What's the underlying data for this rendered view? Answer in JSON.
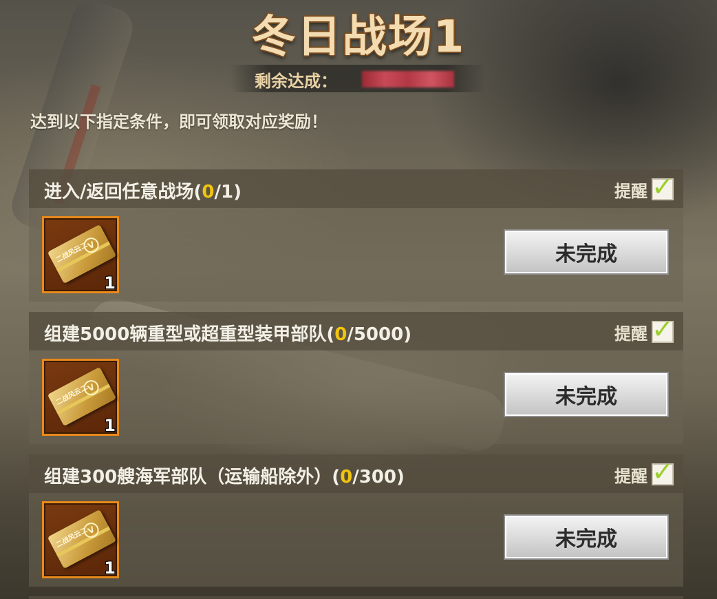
{
  "page": {
    "title": "冬日战场1",
    "remaining_label": "剩余达成：",
    "instruction": "达到以下指定条件，即可领取对应奖励！"
  },
  "colors": {
    "title": "#f3dcb2",
    "progress_highlight": "#f1c40f",
    "check": "#9bcf2a",
    "reward_border": "#e88a1a"
  },
  "tasks": [
    {
      "title_prefix": "进入/返回任意战场(",
      "progress_current": "0",
      "title_suffix": "/1)",
      "remind_label": "提醒",
      "remind_checked": true,
      "reward_icon": "ticket-icon",
      "reward_ticket_text": "二战风云二",
      "reward_count": "1",
      "status_label": "未完成"
    },
    {
      "title_prefix": "组建5000辆重型或超重型装甲部队(",
      "progress_current": "0",
      "title_suffix": "/5000)",
      "remind_label": "提醒",
      "remind_checked": true,
      "reward_icon": "ticket-icon",
      "reward_ticket_text": "二战风云二",
      "reward_count": "1",
      "status_label": "未完成"
    },
    {
      "title_prefix": "组建300艘海军部队（运输船除外）(",
      "progress_current": "0",
      "title_suffix": "/300)",
      "remind_label": "提醒",
      "remind_checked": true,
      "reward_icon": "ticket-icon",
      "reward_ticket_text": "二战风云二",
      "reward_count": "1",
      "status_label": "未完成"
    }
  ],
  "icons": {
    "check": "✓",
    "coin": "V"
  }
}
